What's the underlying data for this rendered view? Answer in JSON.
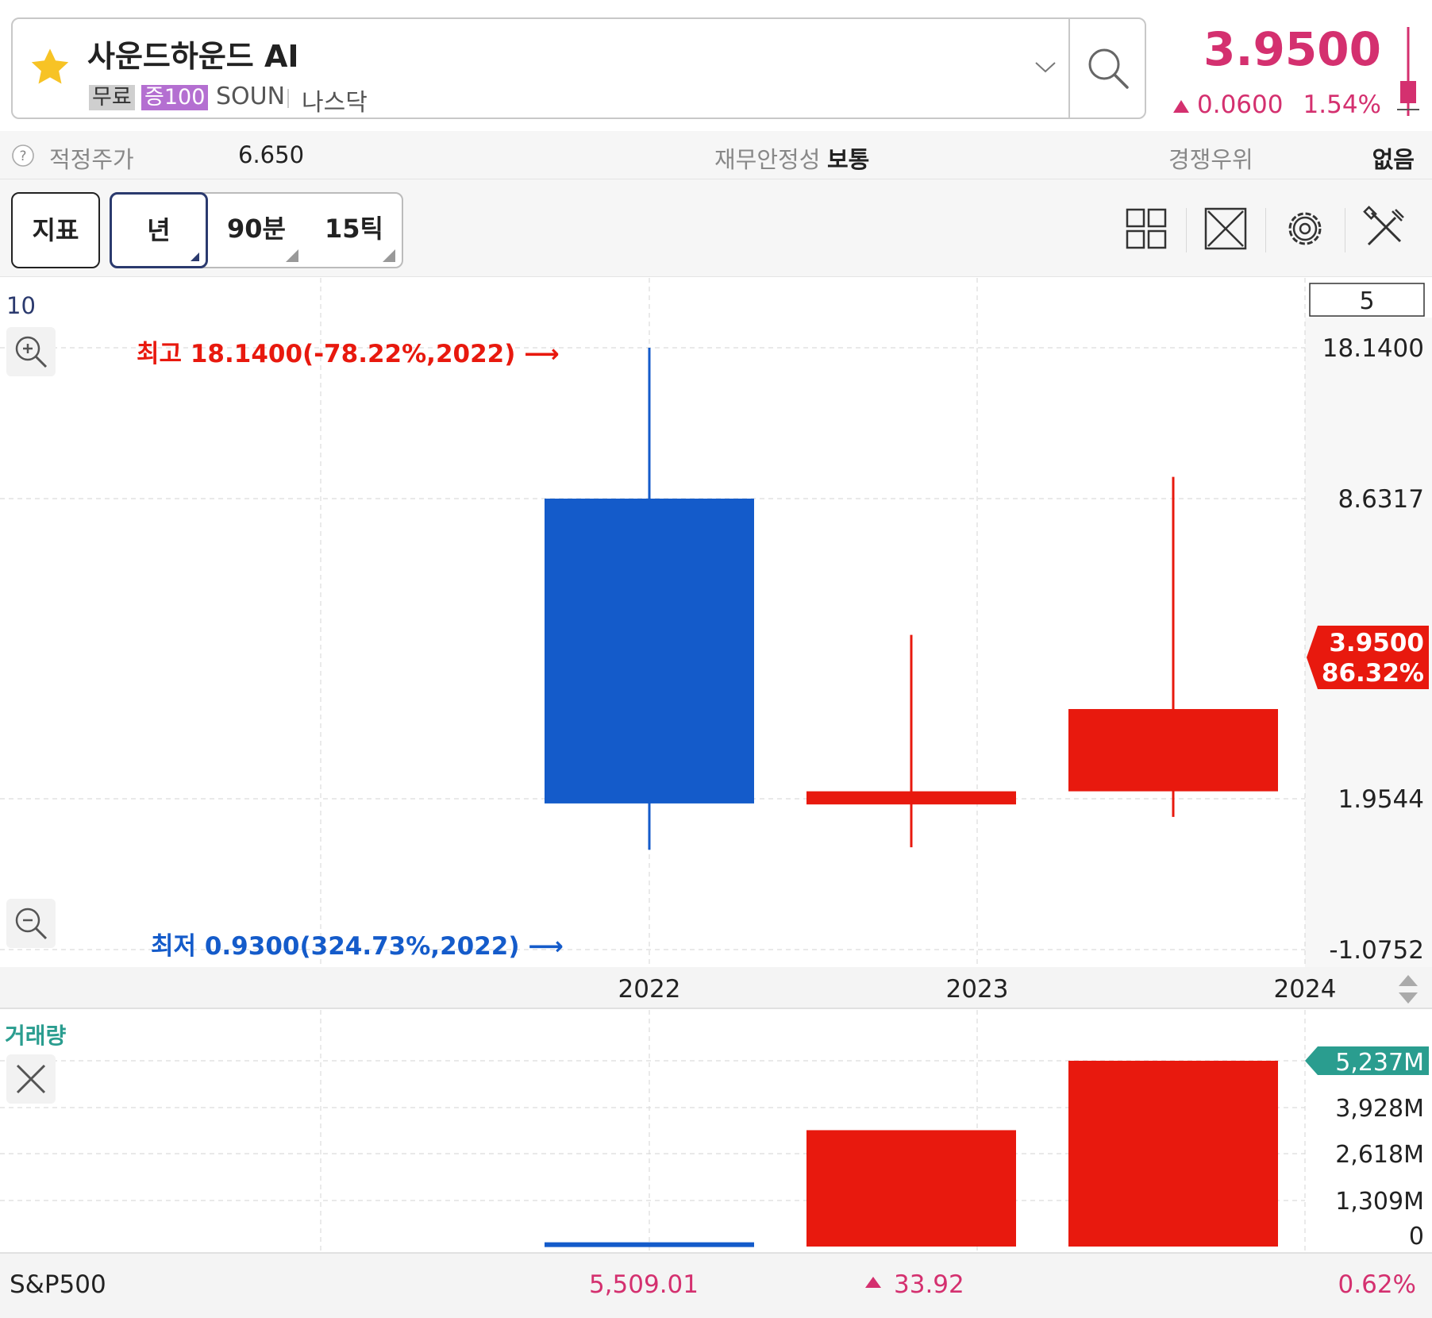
{
  "header": {
    "stock_name": "사운드하운드 AI",
    "badge_free": "무료",
    "badge_margin": "증100",
    "ticker": "SOUN",
    "exchange": "나스닥",
    "price": "3.9500",
    "change_abs": "0.0600",
    "change_pct": "1.54%",
    "favorite_icon": "star-icon",
    "search_icon": "search-icon"
  },
  "info_row": {
    "fair_price_label": "적정주가",
    "fair_price_value": "6.650",
    "stability_label": "재무안정성",
    "stability_value": "보통",
    "competitive_label": "경쟁우위",
    "competitive_value": "없음"
  },
  "toolbar": {
    "indicator_label": "지표",
    "period_year": "년",
    "period_90min": "90분",
    "period_15tick": "15틱",
    "icons": [
      "layout-grid-icon",
      "fullscreen-icon",
      "settings-icon",
      "tools-icon"
    ]
  },
  "colors": {
    "up": "#e8190e",
    "down": "#145bca",
    "accent_price": "#d4306f",
    "volume_label": "#2a9d8f"
  },
  "chart_data": [
    {
      "type": "candlestick",
      "top_left_label": "10",
      "count_box": "5",
      "categories": [
        "2022",
        "2023",
        "2024"
      ],
      "candles": [
        {
          "x": "2022",
          "open": 8.6317,
          "high": 18.14,
          "low": 0.93,
          "close": 1.86
        },
        {
          "x": "2023",
          "open": 1.84,
          "high": 5.6,
          "low": 0.98,
          "close": 2.12
        },
        {
          "x": "2024",
          "open": 2.12,
          "high": 10.0,
          "low": 1.59,
          "close": 3.95
        }
      ],
      "y_ticks": [
        "18.1400",
        "8.6317",
        "1.9544",
        "-1.0752"
      ],
      "current_price_label": "3.9500",
      "current_pct_label": "86.32%",
      "high_annotation": "최고 18.1400(-78.22%,2022) ⟶",
      "low_annotation": "최저 0.9300(324.73%,2022) ⟶",
      "scale": "log"
    },
    {
      "type": "bar",
      "title": "거래량",
      "categories": [
        "2022",
        "2023",
        "2024"
      ],
      "values": [
        120,
        3280,
        5237
      ],
      "value_unit": "M",
      "ylim": [
        0,
        5237
      ],
      "y_ticks": [
        "5,237M",
        "3,928M",
        "2,618M",
        "1,309M",
        "0"
      ],
      "colors": [
        "#145bca",
        "#e8190e",
        "#e8190e"
      ]
    }
  ],
  "footer": {
    "index_name": "S&P500",
    "index_value": "5,509.01",
    "index_change": "33.92",
    "index_pct": "0.62%"
  }
}
